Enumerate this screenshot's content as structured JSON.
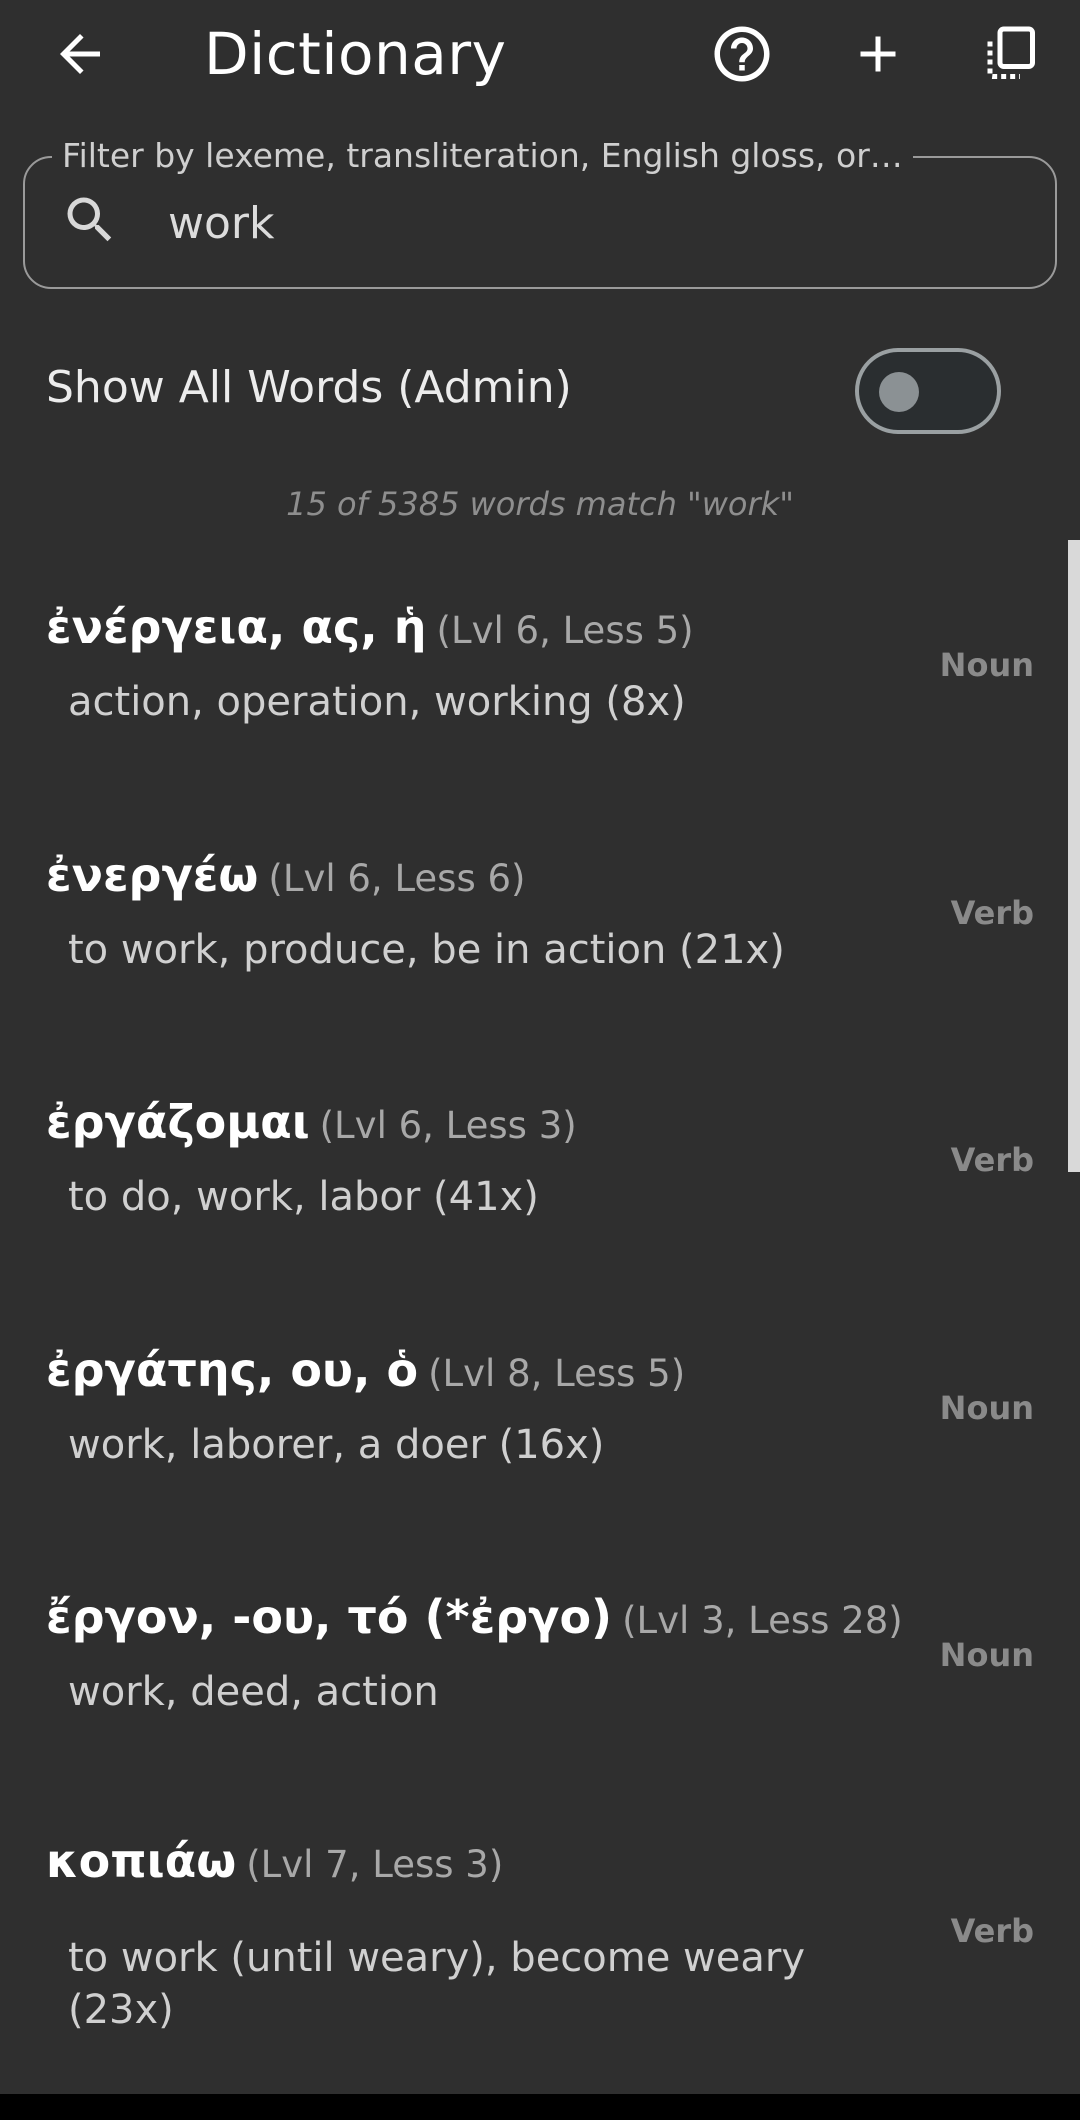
{
  "header": {
    "title": "Dictionary",
    "back_icon": "arrow-left-icon",
    "help_icon": "help-circle-icon",
    "add_icon": "plus-icon",
    "copy_icon": "copy-icon"
  },
  "search": {
    "label": "Filter by lexeme, transliteration, English gloss, or…",
    "value": "work"
  },
  "admin_toggle": {
    "label": "Show All Words (Admin)",
    "on": false
  },
  "match_count": "15 of 5385 words match \"work\"",
  "entries": [
    {
      "lexeme": "ἐνέργεια, ας, ἡ",
      "level": "(Lvl 6, Less 5)",
      "gloss": "action, operation, working (8x)",
      "pos": "Noun"
    },
    {
      "lexeme": "ἐνεργέω",
      "level": "(Lvl 6, Less 6)",
      "gloss": "to work, produce, be in action (21x)",
      "pos": "Verb"
    },
    {
      "lexeme": "ἐργάζομαι",
      "level": "(Lvl 6, Less 3)",
      "gloss": "to do, work, labor (41x)",
      "pos": "Verb"
    },
    {
      "lexeme": "ἐργάτης, ου, ὁ",
      "level": "(Lvl 8, Less 5)",
      "gloss": "work, laborer, a doer (16x)",
      "pos": "Noun"
    },
    {
      "lexeme": "ἔργον, -ου, τό (*ἐργο)",
      "level": "(Lvl 3, Less 28)",
      "gloss": "work, deed, action",
      "pos": "Noun"
    },
    {
      "lexeme": "κοπιάω",
      "level": "(Lvl 7, Less 3)",
      "gloss": "to work (until weary), become weary (23x)",
      "pos": "Verb"
    }
  ],
  "colors": {
    "background": "#2f2f2f",
    "text_primary": "#ffffff",
    "text_secondary": "#a8a8a8",
    "pos_label": "#8a8a8a"
  }
}
